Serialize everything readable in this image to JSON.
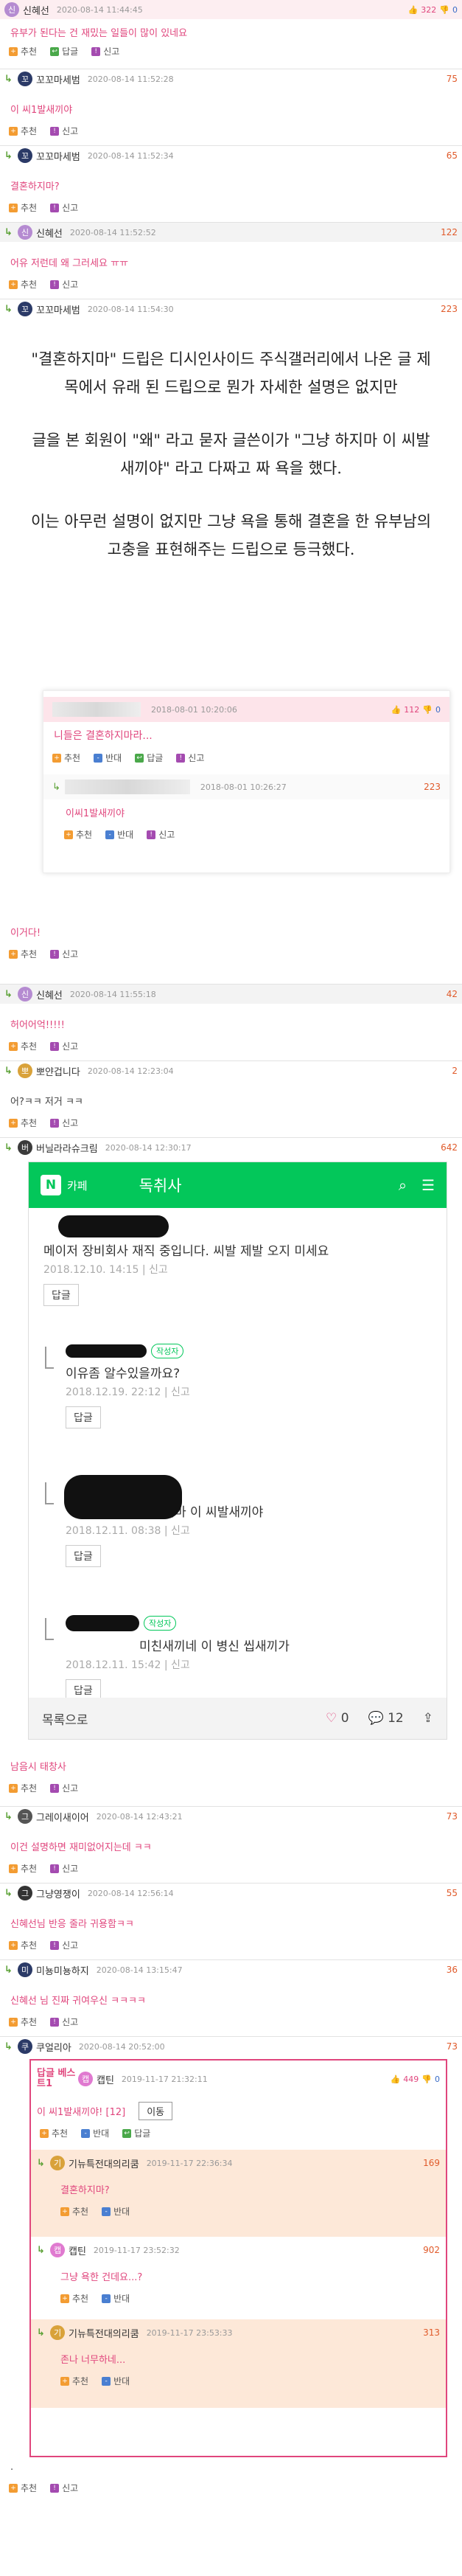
{
  "labels": {
    "recommend": "추천",
    "report": "신고",
    "oppose": "반대",
    "reply": "답글"
  },
  "c1": {
    "nick": "신혜선",
    "date": "2020-08-14 11:44:45",
    "up": "322",
    "down": "0",
    "body": "유부가 된다는 건 재밌는 일들이 많이 있네요"
  },
  "c2": {
    "nick": "꼬꼬마세범",
    "date": "2020-08-14 11:52:28",
    "count": "75",
    "body": "이 씨1발새끼야"
  },
  "c3": {
    "nick": "꼬꼬마세범",
    "date": "2020-08-14 11:52:34",
    "count": "65",
    "body": "결혼하지마?"
  },
  "c4": {
    "nick": "신혜선",
    "date": "2020-08-14 11:52:52",
    "count": "122",
    "body": "어유 저런데 왜 그러세요 ㅠㅠ"
  },
  "c5": {
    "nick": "꼬꼬마세범",
    "date": "2020-08-14 11:54:30",
    "count": "223",
    "p1": "\"결혼하지마\" 드립은 디시인사이드 주식갤러리에서 나온 글 제목에서 유래 된 드립으로 뭔가 자세한 설명은 없지만",
    "p2": "글을 본 회원이 \"왜\" 라고 묻자 글쓴이가 \"그냥 하지마 이 씨발새끼야\" 라고 다짜고 짜 욕을 했다.",
    "p3": "이는 아무런 설명이 없지만 그냥 욕을 통해 결혼을 한 유부남의 고충을 표현해주는 드립으로 등극했다.",
    "quote": {
      "date1": "2018-08-01 10:20:06",
      "up1": "112",
      "down1": "0",
      "body1": "니들은 결혼하지마라...",
      "date2": "2018-08-01 10:26:27",
      "count2": "223",
      "body2": "이씨1발새끼야"
    },
    "body": "이거다!"
  },
  "c6": {
    "nick": "신혜선",
    "date": "2020-08-14 11:55:18",
    "count": "42",
    "body": "허어어억!!!!!"
  },
  "c7": {
    "nick": "뽀얀겁니다",
    "date": "2020-08-14 12:23:04",
    "count": "2",
    "body": "어?ㅋㅋ 저거 ㅋㅋ"
  },
  "c8": {
    "nick": "버닐라라슈크림",
    "date": "2020-08-14 12:30:17",
    "count": "642",
    "cafe": {
      "name": "카페",
      "title": "독취사",
      "m1": "메이저 장비회사 재직 중입니다. 씨발 제발 오지 미세요",
      "m1_meta": "2018.12.10. 14:15  |  신고",
      "m2": "이유좀 알수있을까요?",
      "m2_meta": "2018.12.19. 22:12  |  신고",
      "writer": "작성자",
      "m3": "그냥 하지마 이 씨발새끼야",
      "m3_meta": "2018.12.11. 08:38  |  신고",
      "m4": "미친새끼네 이 병신 씹새끼가",
      "m4_meta": "2018.12.11. 15:42  |  신고",
      "reply_btn": "답글",
      "list": "목록으로",
      "likes": "0",
      "comments": "12"
    },
    "body": "남음시 태창사"
  },
  "c9": {
    "nick": "그레이새이어",
    "date": "2020-08-14 12:43:21",
    "count": "73",
    "body": "이건 설명하면 재미없어지는데 ㅋㅋ"
  },
  "c10": {
    "nick": "그냥영쟁이",
    "date": "2020-08-14 12:56:14",
    "count": "55",
    "body": "신혜선님 반응 줄라 귀용함ㅋㅋ"
  },
  "c11": {
    "nick": "미뇽미뇽하지",
    "date": "2020-08-14 13:15:47",
    "count": "36",
    "body": "신혜선 님 진짜 귀여우신 ㅋㅋㅋㅋ"
  },
  "c12": {
    "nick": "쿠얼리아",
    "date": "2020-08-14 20:52:00",
    "count": "73",
    "best": {
      "badge": "답글 베스트1",
      "nick": "캡틴",
      "date": "2019-11-17 21:32:11",
      "up": "449",
      "down": "0",
      "body": "이 씨1발새끼야! [12]",
      "move": "이동",
      "r1_nick": "기뉴특전대의리쿰",
      "r1_date": "2019-11-17 22:36:34",
      "r1_count": "169",
      "r1_body": "결혼하지마?",
      "r2_nick": "캡틴",
      "r2_date": "2019-11-17 23:52:32",
      "r2_count": "902",
      "r2_body": "그냥 욕한 건데요...?",
      "r3_nick": "기뉴특전대의리쿰",
      "r3_date": "2019-11-17 23:53:33",
      "r3_count": "313",
      "r3_body": "존나 너무하네..."
    },
    "body": "."
  },
  "colors": {
    "accent": "#e0467d",
    "cafe_green": "#03c75a",
    "reply_green": "#5aa034"
  }
}
